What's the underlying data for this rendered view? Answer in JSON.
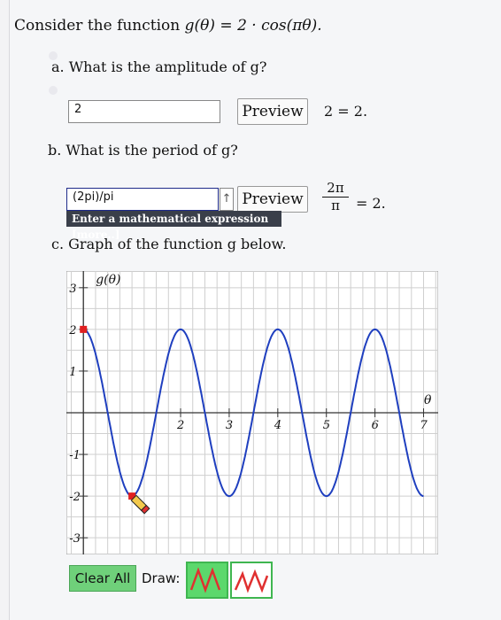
{
  "question": {
    "prefix": "Consider the function ",
    "formula": "g(θ) = 2 · cos(πθ)."
  },
  "part_a": {
    "label": "a. What is the amplitude of g?",
    "input_value": "2",
    "preview_label": "Preview",
    "result": "2 = 2."
  },
  "part_b": {
    "label": "b. What is the period of g?",
    "input_value": "(2pi)/pi",
    "preview_label": "Preview",
    "hint": "Enter a mathematical expression [more..]",
    "result_num": "2π",
    "result_den": "π",
    "result_rest": "= 2."
  },
  "part_c": {
    "label": "c. Graph of the function g below."
  },
  "chart_data": {
    "type": "line",
    "ylabel": "g(θ)",
    "xlabel": "θ",
    "xlim": [
      -0.35,
      7.3
    ],
    "ylim": [
      -3.4,
      3.4
    ],
    "x_ticks": [
      "2",
      "3",
      "4",
      "5",
      "6",
      "7"
    ],
    "y_ticks": [
      "3",
      "2",
      "1",
      "-1",
      "-2",
      "-3"
    ],
    "grid": true,
    "series": [
      {
        "function": "2*cos(pi*x)",
        "x_range": [
          0,
          7
        ],
        "color": "#1f3fbf"
      }
    ],
    "points": [
      {
        "x": 0,
        "y": 2,
        "color": "#e02020"
      },
      {
        "x": 1,
        "y": -2,
        "color": "#e02020"
      }
    ]
  },
  "toolbar": {
    "clear_label": "Clear All",
    "draw_label": "Draw:"
  },
  "icons": {
    "pencil": "pencil-icon",
    "up_arrow": "arrow-up-icon",
    "wave_tool_1": "sine-wave-icon",
    "wave_tool_2": "cosine-wave-icon"
  }
}
